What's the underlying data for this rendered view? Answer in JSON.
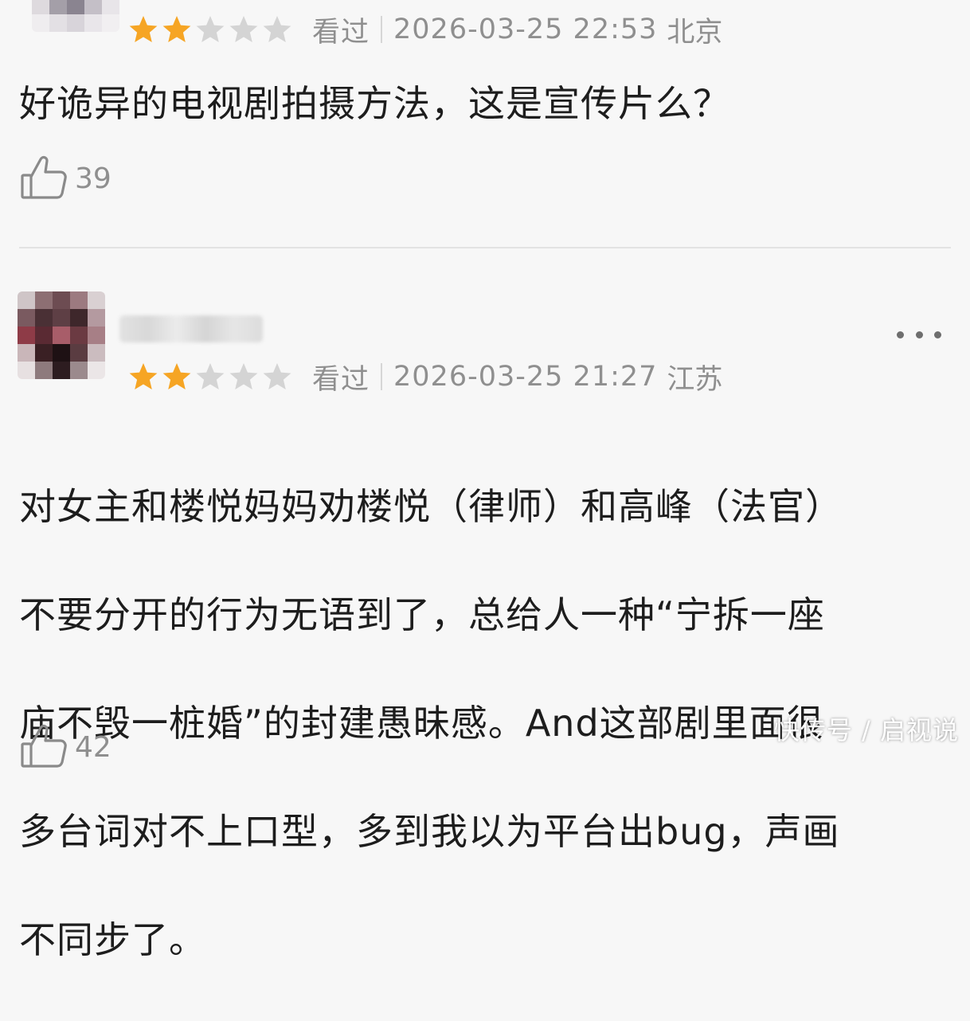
{
  "colors": {
    "star_filled": "#f6a524",
    "star_empty": "#d4d4d4",
    "meta_text": "#8f8f8f",
    "body_text": "#1d1d1d",
    "background": "#f7f7f7"
  },
  "comments": [
    {
      "rating": 2,
      "rating_max": 5,
      "status": "看过",
      "datetime": "2026-03-25 22:53",
      "location": "北京",
      "text": "好诡异的电视剧拍摄方法，这是宣传片么？",
      "likes": "39"
    },
    {
      "rating": 2,
      "rating_max": 5,
      "status": "看过",
      "datetime": "2026-03-25 21:27",
      "location": "江苏",
      "text_lines": [
        "对女主和楼悦妈妈劝楼悦（律师）和高峰（法官）",
        "不要分开的行为无语到了，总给人一种“宁拆一座",
        "庙不毁一桩婚”的封建愚昧感。And这部剧里面很",
        "多台词对不上口型，多到我以为平台出bug，声画",
        "不同步了。"
      ],
      "likes": "42"
    }
  ],
  "icons": {
    "like": "thumbs-up-icon",
    "more": "more-dots-icon",
    "star": "star-icon"
  },
  "watermark": "快传号 / 启视说"
}
